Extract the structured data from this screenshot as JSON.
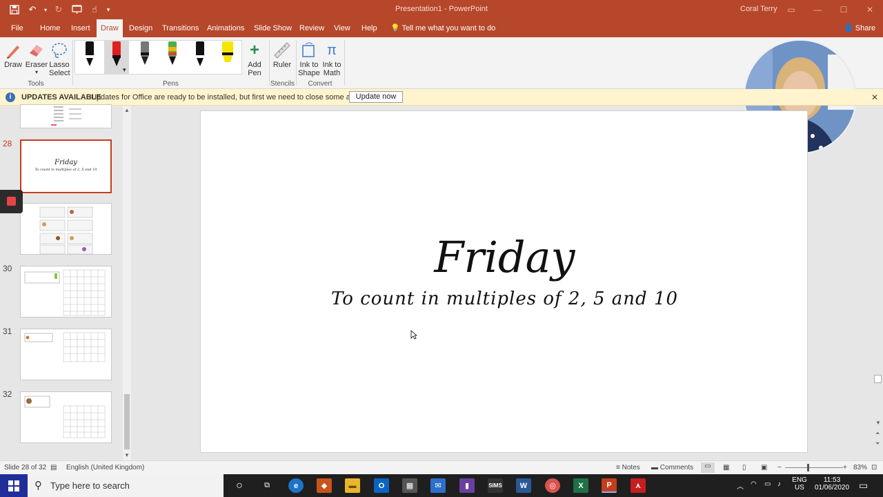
{
  "window": {
    "title": "Presentation1  -  PowerPoint",
    "user": "Coral Terry",
    "share": "Share"
  },
  "tabs": [
    "File",
    "Home",
    "Insert",
    "Draw",
    "Design",
    "Transitions",
    "Animations",
    "Slide Show",
    "Review",
    "View",
    "Help"
  ],
  "tell_me": "Tell me what you want to do",
  "ribbon": {
    "tools": {
      "draw": "Draw",
      "eraser": "Eraser",
      "lasso1": "Lasso",
      "lasso2": "Select",
      "label": "Tools"
    },
    "pens": {
      "label": "Pens",
      "add1": "Add",
      "add2": "Pen"
    },
    "stencils": {
      "ruler": "Ruler",
      "label": "Stencils"
    },
    "convert": {
      "shape1": "Ink to",
      "shape2": "Shape",
      "math1": "Ink to",
      "math2": "Math",
      "label": "Convert"
    }
  },
  "update_bar": {
    "title": "UPDATES AVAILABLE",
    "message": "Updates for Office are ready to be installed, but first we need to close some apps.",
    "button": "Update now"
  },
  "thumbnails": [
    {
      "num": "",
      "title": "",
      "subtitle": ""
    },
    {
      "num": "28",
      "title": "Friday",
      "subtitle": "To count in multiples of 2, 5 and 10"
    },
    {
      "num": "",
      "title": "",
      "subtitle": ""
    },
    {
      "num": "30",
      "title": "",
      "subtitle": ""
    },
    {
      "num": "31",
      "title": "",
      "subtitle": ""
    },
    {
      "num": "32",
      "title": "",
      "subtitle": ""
    }
  ],
  "slide": {
    "title": "Friday",
    "subtitle": "To count in multiples of 2,  5 and 10"
  },
  "status": {
    "slide_info": "Slide 28 of 32",
    "language": "English (United Kingdom)",
    "notes": "Notes",
    "comments": "Comments",
    "zoom": "83%"
  },
  "taskbar": {
    "search_placeholder": "Type here to search",
    "lang1": "ENG",
    "lang2": "US",
    "time": "11:53",
    "date": "01/06/2020",
    "sims": "SIMS"
  },
  "colors": {
    "accent": "#b7472a",
    "update_bg": "#fff4ce"
  }
}
